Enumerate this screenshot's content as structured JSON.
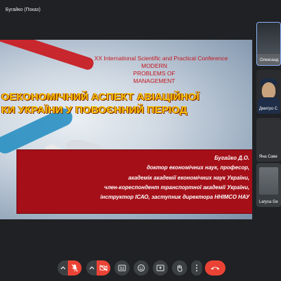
{
  "header": {
    "presenter_title": "Бугайко (Показ)"
  },
  "slide": {
    "conference": {
      "line1": "XX International Scientific and Practical Conference",
      "line2": "MODERN",
      "line3": "PROBLEMS OF",
      "line4": "MANAGEMENT"
    },
    "title": {
      "line1": "ОЕКОНОМІЧНИЙ АСПЕКТ АВІАЦІЙНОЇ",
      "line2": "КИ УКРАЇНИ У ПОВОЄННИЙ ПЕРІОД"
    },
    "author": {
      "name": "Бугайко Д.О.",
      "line1": "доктор економічних наук, професор,",
      "line2": "академік академії економічних наук України,",
      "line3": "член-кореспондент транспортної академії України,",
      "line4": "інструктор ІСАО, заступник директора ННІМСО НАУ"
    }
  },
  "participants": [
    {
      "name": "Олександ"
    },
    {
      "name": "Дмитро С"
    },
    {
      "name": "Яна Саве"
    },
    {
      "name": "Larysa Ge"
    }
  ],
  "controls": {
    "mic_state": "muted",
    "camera_state": "off",
    "colors": {
      "button_bg": "#3c4043",
      "muted_red": "#ea4335",
      "end_call": "#ea4335"
    }
  }
}
